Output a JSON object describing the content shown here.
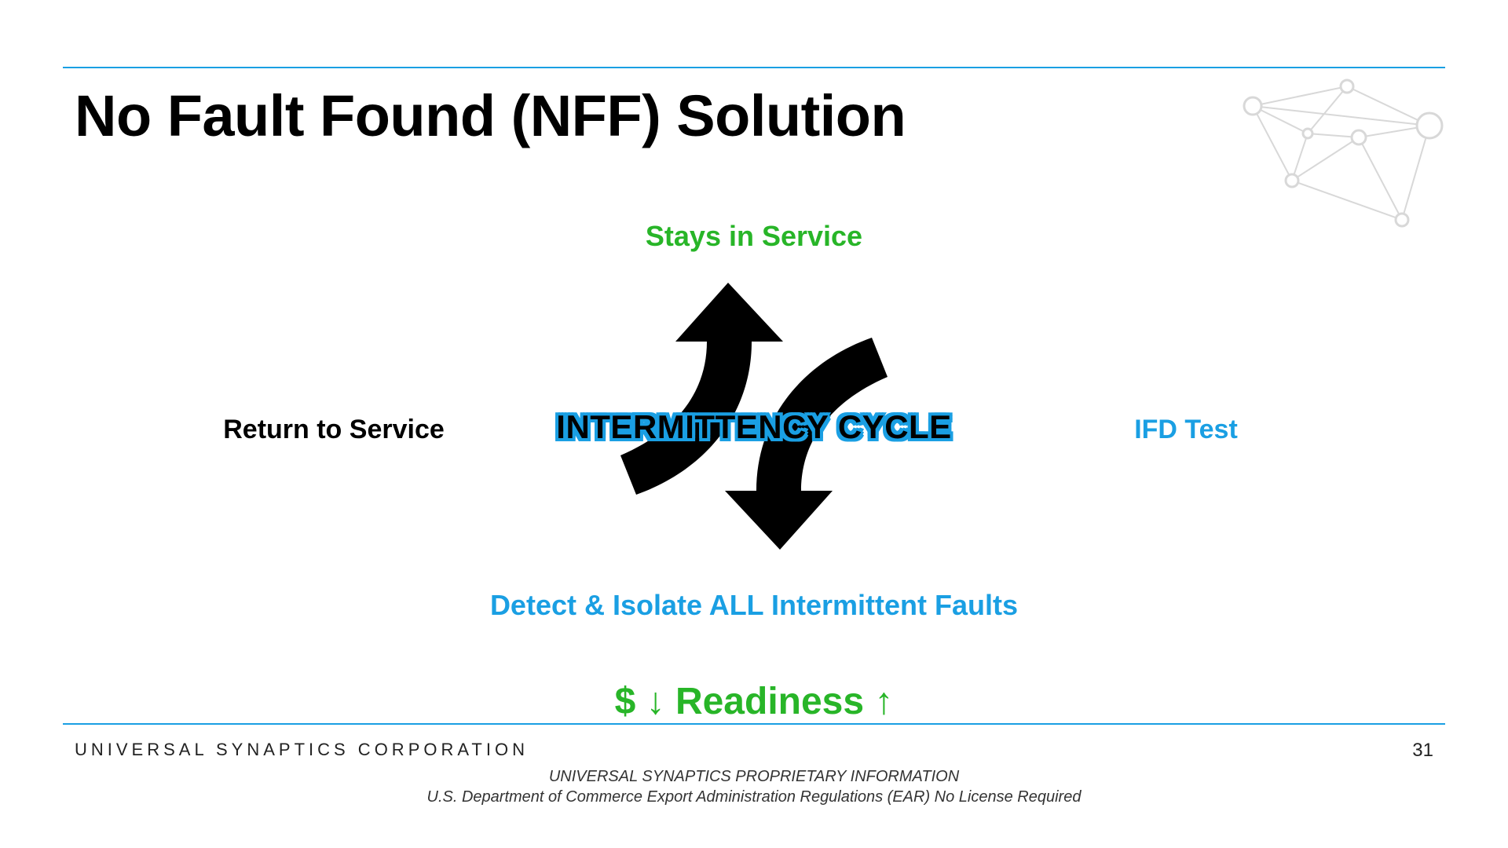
{
  "title": "No Fault Found (NFF) Solution",
  "labels": {
    "top": "Stays in Service",
    "left": "Return to Service",
    "right": "IFD Test",
    "bottom": "Detect & Isolate ALL Intermittent Faults",
    "center": "INTERMITTENCY CYCLE"
  },
  "summary": "$ ↓ Readiness ↑",
  "footer": {
    "company": "UNIVERSAL SYNAPTICS CORPORATION",
    "page": "31",
    "line1": "UNIVERSAL SYNAPTICS PROPRIETARY INFORMATION",
    "line2": "U.S. Department of Commerce Export Administration Regulations (EAR) No License Required"
  },
  "colors": {
    "accent_blue": "#1a9fe3",
    "accent_green": "#28b528"
  }
}
